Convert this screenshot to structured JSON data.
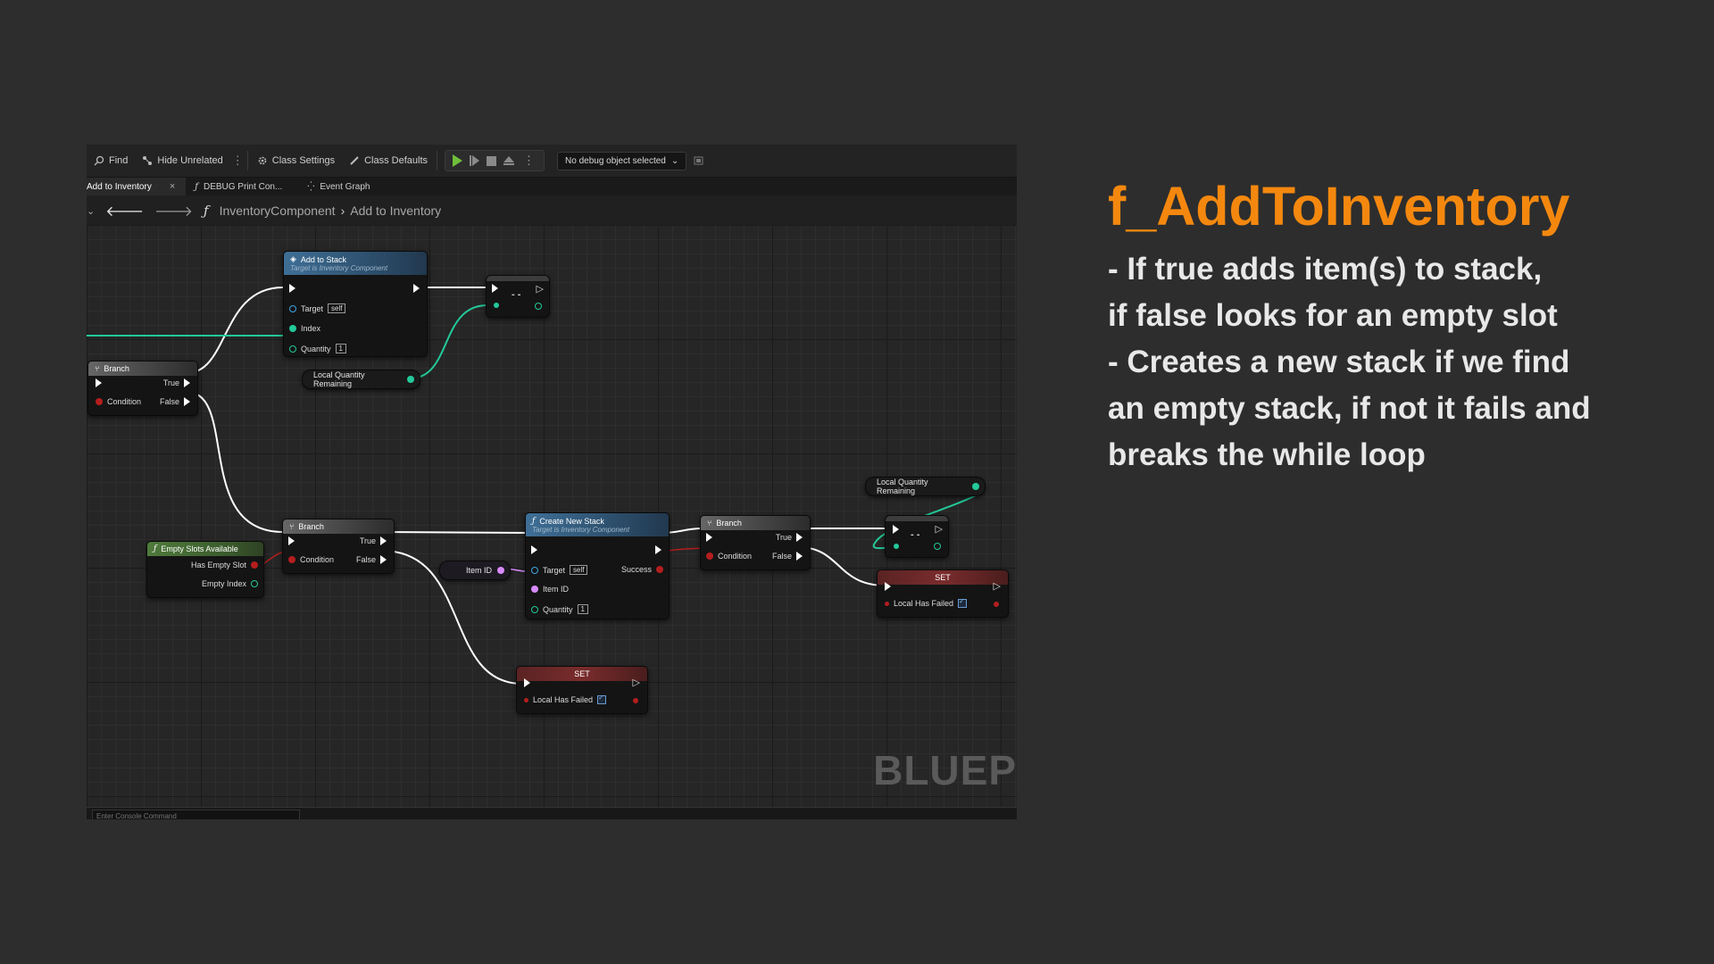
{
  "toolbar": {
    "find": "Find",
    "hide_unrelated": "Hide Unrelated",
    "class_settings": "Class Settings",
    "class_defaults": "Class Defaults",
    "debug_select": "No debug object selected"
  },
  "tabs": [
    {
      "label": "Add to Inventory",
      "active": true
    },
    {
      "label": "DEBUG Print Con...",
      "active": false
    },
    {
      "label": "Event Graph",
      "active": false
    }
  ],
  "breadcrumb": {
    "component": "InventoryComponent",
    "function": "Add to Inventory"
  },
  "nodes": {
    "add_to_stack": {
      "title": "Add to Stack",
      "subtitle": "Target is Inventory Component",
      "target": "Target",
      "target_value": "self",
      "index": "Index",
      "quantity": "Quantity",
      "quantity_value": "1"
    },
    "branch1": {
      "title": "Branch",
      "true": "True",
      "false": "False",
      "condition": "Condition"
    },
    "local_qty_1": {
      "label": "Local Quantity Remaining"
    },
    "op1": {
      "label": "- -"
    },
    "branch2": {
      "title": "Branch",
      "true": "True",
      "false": "False",
      "condition": "Condition"
    },
    "empty_slots": {
      "title": "Empty Slots Available",
      "has_empty_slot": "Has Empty Slot",
      "empty_index": "Empty Index"
    },
    "item_id": {
      "label": "Item ID"
    },
    "create_new_stack": {
      "title": "Create New Stack",
      "subtitle": "Target is Inventory Component",
      "target": "Target",
      "target_value": "self",
      "success": "Success",
      "item_id": "Item ID",
      "quantity": "Quantity",
      "quantity_value": "1"
    },
    "branch3": {
      "title": "Branch",
      "true": "True",
      "false": "False",
      "condition": "Condition"
    },
    "local_qty_2": {
      "label": "Local Quantity Remaining"
    },
    "op2": {
      "label": "- -"
    },
    "set1": {
      "title": "SET",
      "var": "Local Has Failed"
    },
    "set2": {
      "title": "SET",
      "var": "Local Has Failed"
    }
  },
  "watermark": "BLUEP",
  "console_placeholder": "Enter Console Command",
  "slide": {
    "title": "f_AddToInventory",
    "lines": [
      "- If true adds item(s) to stack,",
      "if false looks for an empty slot",
      "- Creates a new stack if we find",
      "an empty stack, if not it fails and",
      "breaks the while loop"
    ]
  },
  "colors": {
    "title_orange": "#f4880f",
    "exec_wire": "#ffffff",
    "int_wire": "#23c99a",
    "bool_wire": "#b51e1e",
    "name_wire": "#d88bff",
    "function_header": "#3f6f96",
    "branch_header": "#666666",
    "pure_header": "#4f7b3c",
    "set_header": "#7a2c2c"
  }
}
